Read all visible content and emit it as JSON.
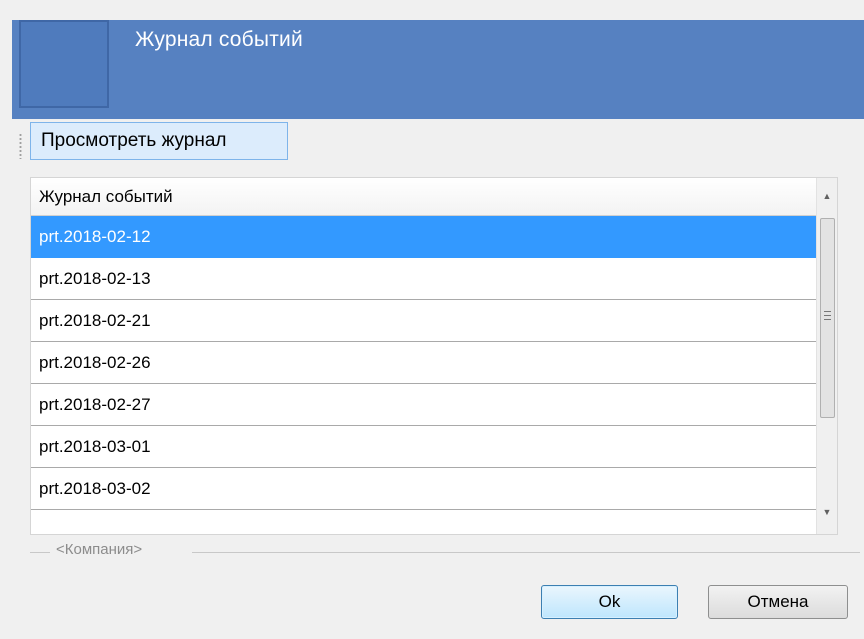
{
  "header": {
    "title": "Журнал событий",
    "color": "#5681c1"
  },
  "toolbar": {
    "view_log_label": "Просмотреть журнал"
  },
  "grid": {
    "column_header": "Журнал событий",
    "rows": [
      "prt.2018-02-12",
      "prt.2018-02-13",
      "prt.2018-02-21",
      "prt.2018-02-26",
      "prt.2018-02-27",
      "prt.2018-03-01",
      "prt.2018-03-02"
    ],
    "selected_index": 0,
    "selection_color": "#3399ff"
  },
  "footer": {
    "company_label": "<Компания>",
    "ok_label": "Ok",
    "cancel_label": "Отмена"
  },
  "icons": {
    "scroll_up": "up-triangle",
    "scroll_down": "down-triangle",
    "grip": "toolbar-grip"
  }
}
